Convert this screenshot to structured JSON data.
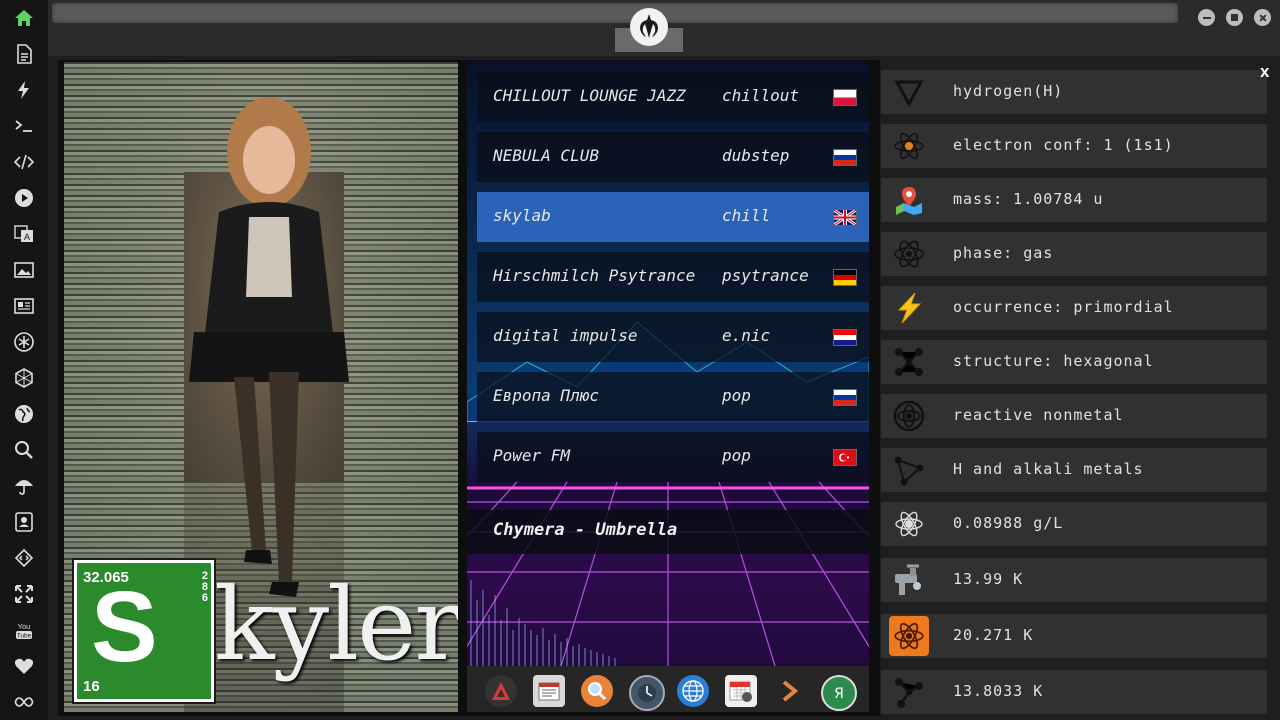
{
  "sidebar": {
    "items": [
      {
        "icon": "home-icon",
        "color": "#5fd35f"
      },
      {
        "icon": "document-icon"
      },
      {
        "icon": "lightning-icon"
      },
      {
        "icon": "terminal-icon",
        "glyph": ">_"
      },
      {
        "icon": "code-icon",
        "glyph": "</>"
      },
      {
        "icon": "play-icon"
      },
      {
        "icon": "translate-icon"
      },
      {
        "icon": "image-icon"
      },
      {
        "icon": "newspaper-icon"
      },
      {
        "icon": "asterisk-icon"
      },
      {
        "icon": "hexagon-icon"
      },
      {
        "icon": "globe-icon"
      },
      {
        "icon": "search-icon"
      },
      {
        "icon": "umbrella-icon"
      },
      {
        "icon": "contact-icon"
      },
      {
        "icon": "code-diamond-icon"
      },
      {
        "icon": "expand-icon"
      },
      {
        "icon": "youtube-icon",
        "glyph": "You Tube"
      },
      {
        "icon": "heart-icon"
      },
      {
        "icon": "infinity-icon"
      }
    ]
  },
  "topbar": {
    "emblem_icon": "rebel-alliance-icon"
  },
  "poster": {
    "element_mass": "32.065",
    "element_shells": [
      "2",
      "8",
      "6"
    ],
    "element_symbol": "S",
    "element_number": "16",
    "title": "kyler"
  },
  "radio": {
    "stations": [
      {
        "name": "CHILLOUT LOUNGE JAZZ",
        "genre": "chillout",
        "flag": "PL"
      },
      {
        "name": "NEBULA CLUB",
        "genre": "dubstep",
        "flag": "RU"
      },
      {
        "name": "skylab",
        "genre": "chill",
        "flag": "UK",
        "selected": true
      },
      {
        "name": "Hirschmilch Psytrance",
        "genre": "psytrance",
        "flag": "DE"
      },
      {
        "name": "digital impulse",
        "genre": "e.nic",
        "flag": "HR"
      },
      {
        "name": "Европа Плюс",
        "genre": "pop",
        "flag": "RU"
      },
      {
        "name": "Power FM",
        "genre": "pop",
        "flag": "TR"
      }
    ],
    "now_playing": "Chymera - Umbrella",
    "dock": [
      "launcher-icon",
      "calendar-news-icon",
      "search-app-icon",
      "clock-icon",
      "browser-globe-icon",
      "calendar-icon",
      "arrow-app-icon",
      "yandex-icon"
    ]
  },
  "info": {
    "close_label": "x",
    "rows": [
      {
        "icon": "triangle-down-icon",
        "text": "hydrogen(H)"
      },
      {
        "icon": "atom-orbit-icon",
        "text": "electron conf: 1 (1s1)"
      },
      {
        "icon": "map-pin-icon",
        "text": "mass: 1.00784 u"
      },
      {
        "icon": "atom-icon",
        "text": "phase: gas"
      },
      {
        "icon": "lightning-bolt-icon",
        "text": "occurrence: primordial"
      },
      {
        "icon": "molecule-icon",
        "text": "structure: hexagonal"
      },
      {
        "icon": "reactor-icon",
        "text": "reactive nonmetal"
      },
      {
        "icon": "graph-nodes-icon",
        "text": "H and alkali metals"
      },
      {
        "icon": "atom-small-icon",
        "text": "0.08988 g/L"
      },
      {
        "icon": "thermometer-tap-icon",
        "text": "13.99 K"
      },
      {
        "icon": "atom-orange-icon",
        "text": "20.271 K"
      },
      {
        "icon": "triple-node-icon",
        "text": "13.8033 K"
      }
    ]
  }
}
